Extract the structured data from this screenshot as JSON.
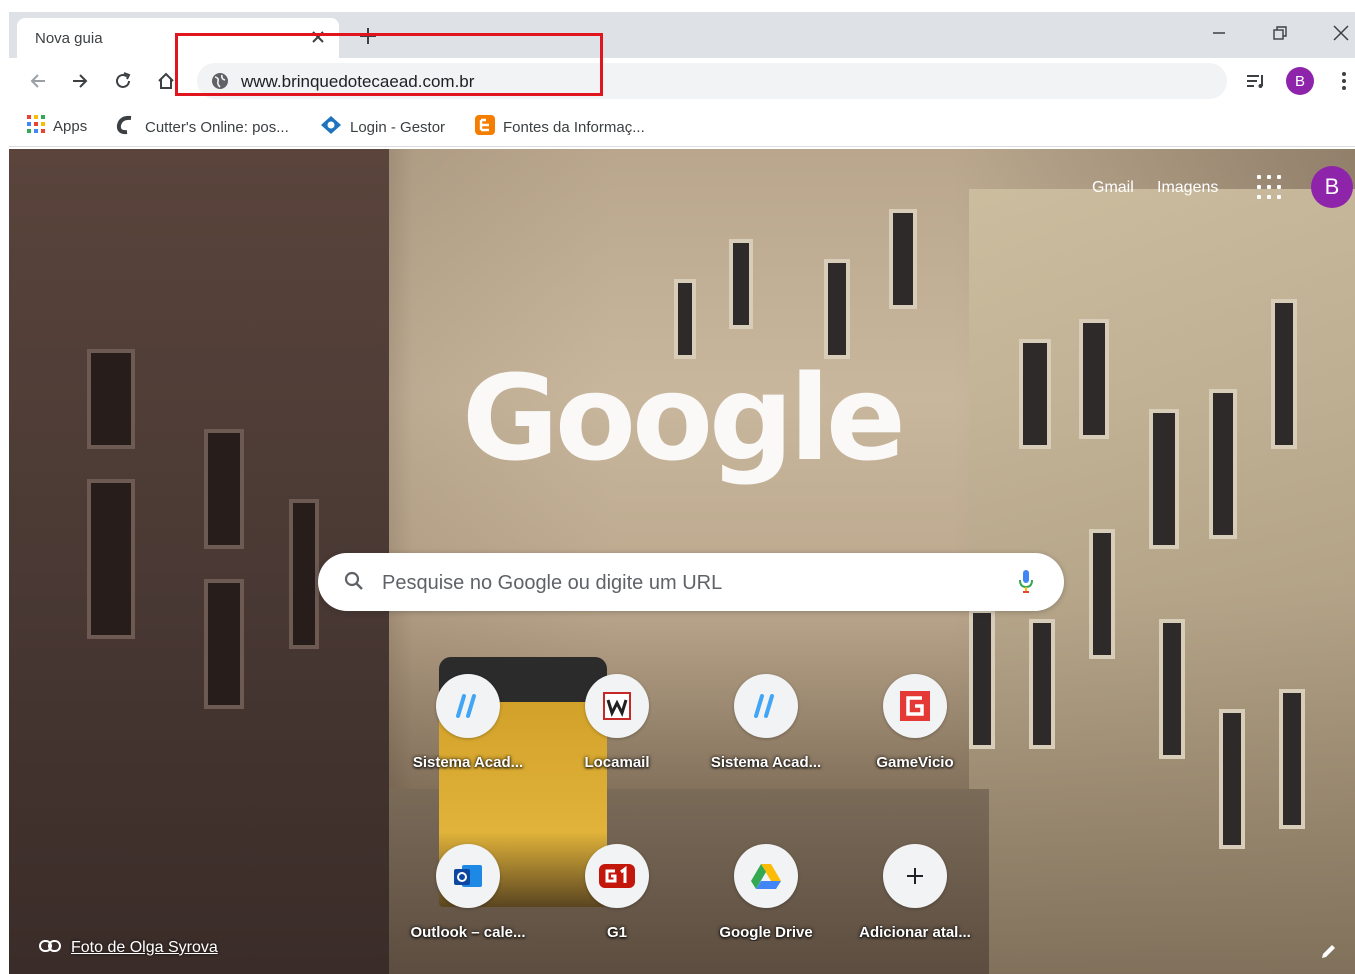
{
  "browser": {
    "tab": {
      "title": "Nova guia"
    },
    "address_bar": {
      "url": "www.brinquedotecaead.com.br"
    },
    "profile_initial": "B",
    "accent_color": "#8e24aa",
    "highlight_color": "#e0151d"
  },
  "bookmarks": [
    {
      "label": "Apps",
      "icon": "apps-grid-icon"
    },
    {
      "label": "Cutter's Online: pos...",
      "icon": "cutters-icon"
    },
    {
      "label": "Login - Gestor",
      "icon": "gestor-icon"
    },
    {
      "label": "Fontes da Informaç...",
      "icon": "blogger-icon"
    }
  ],
  "ntp": {
    "header_links": {
      "gmail": "Gmail",
      "images": "Imagens"
    },
    "profile_initial": "B",
    "logo": "Google",
    "search_placeholder": "Pesquise no Google ou digite um URL",
    "shortcuts": [
      {
        "label": "Sistema Acad...",
        "icon": "sistema-acad-icon"
      },
      {
        "label": "Locamail",
        "icon": "locamail-icon"
      },
      {
        "label": "Sistema Acad...",
        "icon": "sistema-acad-icon"
      },
      {
        "label": "GameVicio",
        "icon": "gamevicio-icon"
      },
      {
        "label": "Outlook – cale...",
        "icon": "outlook-icon"
      },
      {
        "label": "G1",
        "icon": "g1-icon"
      },
      {
        "label": "Google Drive",
        "icon": "google-drive-icon"
      },
      {
        "label": "Adicionar atal...",
        "icon": "add-shortcut-icon"
      }
    ],
    "photo_credit": "Foto de Olga Syrova"
  }
}
